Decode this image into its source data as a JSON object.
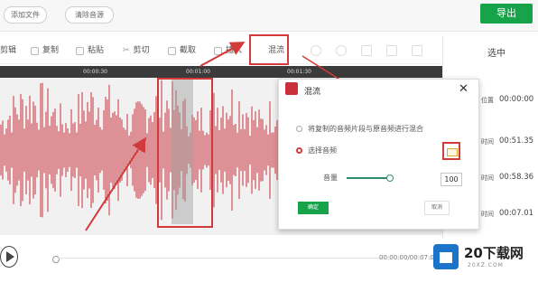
{
  "topbar": {
    "add_file_label": "添加文件",
    "clear_list_label": "清除音源",
    "export_label": "导出"
  },
  "toolbar": {
    "items": [
      {
        "label": "剪辑",
        "icon": "cut-icon"
      },
      {
        "label": "复制",
        "icon": "copy-icon"
      },
      {
        "label": "粘贴",
        "icon": "paste-icon"
      },
      {
        "label": "剪切",
        "icon": "scissors-icon"
      },
      {
        "label": "截取",
        "icon": "crop-icon"
      },
      {
        "label": "插入",
        "icon": "insert-icon"
      },
      {
        "label": "混流",
        "icon": "mix-icon"
      }
    ]
  },
  "ruler": {
    "ticks": [
      "00:00:30",
      "00:01:00",
      "00:01:30"
    ]
  },
  "right_panel": {
    "header": "选中",
    "rows": [
      {
        "label": "位置",
        "value": "00:00:00"
      },
      {
        "label": "时间",
        "value": "00:51.35"
      },
      {
        "label": "时间",
        "value": "00:58.36"
      },
      {
        "label": "时间",
        "value": "00:07.01"
      }
    ]
  },
  "dialog": {
    "title": "混流",
    "option_mix_label": "将复制的音频片段与原音频进行混合",
    "option_select_label": "选择音频",
    "volume_label": "音量",
    "volume_value": "100",
    "ok_label": "确定",
    "cancel_label": "取消"
  },
  "transport": {
    "time": "00:00:00/00:07:01"
  },
  "watermark": {
    "brand": "20下载网",
    "sub": "20XZ.COM"
  },
  "colors": {
    "accent_green": "#16a34a",
    "wave_red": "#c9303a",
    "highlight_red": "#d23b3b"
  }
}
